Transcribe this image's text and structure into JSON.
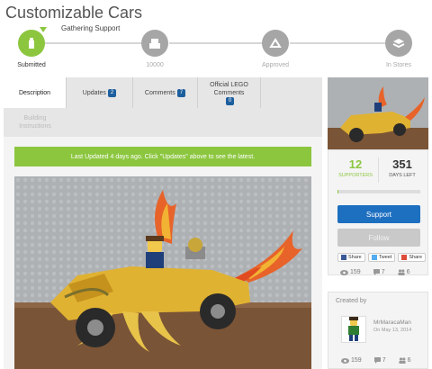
{
  "page": {
    "title": "Customizable Cars"
  },
  "stepper": {
    "gathering_label": "Gathering Support",
    "steps": [
      {
        "label": "Submitted",
        "icon": "lego-brick-icon",
        "done": true
      },
      {
        "label": "10000",
        "icon": "bricks-stack-icon",
        "done": false
      },
      {
        "label": "Approved",
        "icon": "approval-stamp-icon",
        "done": false
      },
      {
        "label": "In Stores",
        "icon": "store-box-icon",
        "done": false
      }
    ]
  },
  "tabs": [
    {
      "label": "Description",
      "badge": null
    },
    {
      "label": "Updates",
      "badge": "2"
    },
    {
      "label": "Comments",
      "badge": "7"
    },
    {
      "label": "Official LEGO Comments",
      "badge": "0"
    },
    {
      "label": "Building Instructions",
      "badge": null
    }
  ],
  "notice": {
    "text": "Last Updated 4 days ago. Click \"Updates\" above to see the latest."
  },
  "sidebar": {
    "supporters": {
      "value": "12",
      "label": "SUPPORTERS"
    },
    "days_left": {
      "value": "351",
      "label": "DAYS LEFT"
    },
    "support_progress": 0.0012,
    "support_button": "Support",
    "follow_button": "Follow",
    "share": {
      "facebook": "Share",
      "twitter": "Tweet",
      "google": "Share"
    },
    "stats": {
      "views": "159",
      "comments": "7",
      "supporters": "6"
    },
    "creator": {
      "heading": "Created by",
      "name": "MrMaracaMan",
      "date": "On May 13, 2014",
      "stats": {
        "views": "159",
        "comments": "7",
        "supporters": "6"
      }
    }
  },
  "colors": {
    "accent_green": "#8cc63f",
    "support_blue": "#1d6fc0",
    "badge_blue": "#1d5f9e"
  }
}
